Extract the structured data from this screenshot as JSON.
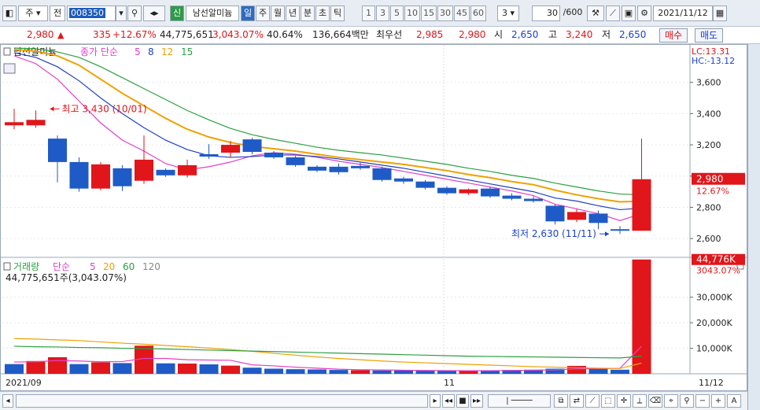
{
  "toolbar": {
    "market": "주",
    "type": "전",
    "code": "008350",
    "name_button": "신",
    "name": "남선알미늄",
    "periods": [
      "일",
      "주",
      "월",
      "년",
      "분",
      "초",
      "틱"
    ],
    "active_period": "일",
    "intervals": [
      "1",
      "3",
      "5",
      "10",
      "15",
      "30",
      "45",
      "60"
    ],
    "count": "3",
    "range": "30",
    "range_total": "/600",
    "date": "2021/11/12"
  },
  "quote": {
    "price": "2,980",
    "change": "335",
    "change_pct": "+12.67%",
    "volume": "44,775,651",
    "volume_ratio": "3,043.07%",
    "turnover": "40.64%",
    "amount": "136,664백만",
    "best_bid_label": "최우선",
    "best_bid": "2,985",
    "best_ask": "2,980",
    "open_label": "시",
    "open": "2,650",
    "high_label": "고",
    "high": "3,240",
    "low_label": "저",
    "low": "2,650",
    "buy_label": "매수",
    "sell_label": "매도"
  },
  "chart_data": [
    {
      "type": "candlestick",
      "legend": {
        "name": "남선알미늄",
        "series_label": "종가 단순",
        "ma_periods": [
          "5",
          "8",
          "12",
          "15"
        ]
      },
      "corner_labels": {
        "lc": "LC:13.31",
        "hc": "HC:-13.12"
      },
      "ylim": [
        2500,
        3820
      ],
      "yticks": [
        2600,
        2800,
        3000,
        3200,
        3400,
        3600
      ],
      "ytick_labels": [
        "2,600",
        "2,800",
        "3,000",
        "3,200",
        "3,400",
        "3,600"
      ],
      "current_price_label": "2,980",
      "current_change_label": "12.67%",
      "candles": [
        {
          "o": 3325,
          "h": 3430,
          "l": 3300,
          "c": 3345
        },
        {
          "o": 3325,
          "h": 3420,
          "l": 3310,
          "c": 3360
        },
        {
          "o": 3240,
          "h": 3260,
          "l": 2960,
          "c": 3090
        },
        {
          "o": 3090,
          "h": 3120,
          "l": 2900,
          "c": 2920
        },
        {
          "o": 2920,
          "h": 3090,
          "l": 2910,
          "c": 3075
        },
        {
          "o": 3050,
          "h": 3070,
          "l": 2905,
          "c": 2935
        },
        {
          "o": 2970,
          "h": 3260,
          "l": 2950,
          "c": 3105
        },
        {
          "o": 3040,
          "h": 3050,
          "l": 2995,
          "c": 3005
        },
        {
          "o": 3005,
          "h": 3105,
          "l": 2990,
          "c": 3070
        },
        {
          "o": 3140,
          "h": 3205,
          "l": 3110,
          "c": 3125
        },
        {
          "o": 3150,
          "h": 3225,
          "l": 3120,
          "c": 3200
        },
        {
          "o": 3235,
          "h": 3245,
          "l": 3140,
          "c": 3155
        },
        {
          "o": 3150,
          "h": 3160,
          "l": 3110,
          "c": 3120
        },
        {
          "o": 3120,
          "h": 3130,
          "l": 3060,
          "c": 3070
        },
        {
          "o": 3060,
          "h": 3070,
          "l": 3025,
          "c": 3035
        },
        {
          "o": 3060,
          "h": 3080,
          "l": 3010,
          "c": 3025
        },
        {
          "o": 3065,
          "h": 3085,
          "l": 3040,
          "c": 3050
        },
        {
          "o": 3050,
          "h": 3060,
          "l": 2965,
          "c": 2975
        },
        {
          "o": 2985,
          "h": 2995,
          "l": 2950,
          "c": 2965
        },
        {
          "o": 2965,
          "h": 2975,
          "l": 2915,
          "c": 2925
        },
        {
          "o": 2925,
          "h": 2935,
          "l": 2880,
          "c": 2890
        },
        {
          "o": 2890,
          "h": 2920,
          "l": 2880,
          "c": 2915
        },
        {
          "o": 2920,
          "h": 2930,
          "l": 2860,
          "c": 2870
        },
        {
          "o": 2875,
          "h": 2890,
          "l": 2845,
          "c": 2855
        },
        {
          "o": 2855,
          "h": 2870,
          "l": 2830,
          "c": 2840
        },
        {
          "o": 2810,
          "h": 2820,
          "l": 2690,
          "c": 2710
        },
        {
          "o": 2720,
          "h": 2790,
          "l": 2705,
          "c": 2770
        },
        {
          "o": 2760,
          "h": 2780,
          "l": 2660,
          "c": 2700
        },
        {
          "o": 2660,
          "h": 2680,
          "l": 2630,
          "c": 2650
        },
        {
          "o": 2650,
          "h": 3240,
          "l": 2650,
          "c": 2980
        }
      ],
      "ma": [
        {
          "period": "5",
          "color": "#e040c8",
          "values": [
            3770,
            3720,
            3620,
            3480,
            3340,
            3230,
            3160,
            3080,
            3040,
            3060,
            3090,
            3130,
            3150,
            3140,
            3120,
            3095,
            3075,
            3055,
            3030,
            3005,
            2980,
            2955,
            2930,
            2905,
            2875,
            2820,
            2790,
            2760,
            2715,
            2760
          ]
        },
        {
          "period": "8",
          "color": "#2040c0",
          "values": [
            3790,
            3760,
            3700,
            3610,
            3500,
            3400,
            3310,
            3230,
            3170,
            3130,
            3120,
            3125,
            3135,
            3135,
            3125,
            3110,
            3090,
            3070,
            3050,
            3025,
            3000,
            2975,
            2950,
            2925,
            2900,
            2860,
            2840,
            2810,
            2785,
            2795
          ]
        },
        {
          "period": "12",
          "color": "#f0a000",
          "values": [
            3810,
            3800,
            3770,
            3710,
            3620,
            3530,
            3450,
            3370,
            3300,
            3250,
            3215,
            3190,
            3175,
            3160,
            3140,
            3120,
            3105,
            3090,
            3075,
            3055,
            3035,
            3010,
            2990,
            2965,
            2945,
            2910,
            2880,
            2855,
            2835,
            2840
          ]
        },
        {
          "period": "15",
          "color": "#2aa040",
          "values": [
            3820,
            3815,
            3795,
            3760,
            3700,
            3630,
            3560,
            3490,
            3420,
            3360,
            3305,
            3265,
            3235,
            3210,
            3185,
            3165,
            3150,
            3135,
            3115,
            3095,
            3075,
            3050,
            3030,
            3005,
            2985,
            2955,
            2930,
            2905,
            2885,
            2880
          ]
        }
      ],
      "annotations": [
        {
          "text": "최고 3,430 (10/01)",
          "index": 1,
          "price": 3430,
          "side": "right",
          "color": "#e0161b"
        },
        {
          "text": "최저 2,630 (11/11)",
          "index": 28,
          "price": 2630,
          "side": "left",
          "color": "#1a3fd3"
        }
      ]
    },
    {
      "type": "bar",
      "legend": {
        "name": "거래량",
        "series_label": "단순",
        "ma_periods": [
          "5",
          "20",
          "60",
          "120"
        ],
        "summary": "44,775,651주(3,043.07%)"
      },
      "ylim": [
        0,
        45000000
      ],
      "yticks": [
        10000000,
        20000000,
        30000000
      ],
      "ytick_labels": [
        "10,000K",
        "20,000K",
        "30,000K"
      ],
      "current_label": "44,776K",
      "current_pct_label": "3043.07%",
      "values": [
        3800000,
        5000000,
        6500000,
        3800000,
        4500000,
        4200000,
        11000000,
        4100000,
        4000000,
        3700000,
        3200000,
        2400000,
        2000000,
        1800000,
        1700000,
        1500000,
        1400000,
        1300000,
        1300000,
        1200000,
        1100000,
        1200000,
        1400000,
        1500000,
        1600000,
        2000000,
        3100000,
        2000000,
        1600000,
        44775651
      ],
      "up": [
        false,
        true,
        true,
        false,
        true,
        false,
        true,
        false,
        true,
        false,
        true,
        false,
        false,
        false,
        false,
        false,
        true,
        false,
        false,
        false,
        false,
        true,
        false,
        false,
        false,
        false,
        true,
        false,
        false,
        true
      ],
      "ma": [
        {
          "period": "5",
          "color": "#e040c8",
          "values": [
            4600,
            4700,
            5200,
            5000,
            4700,
            4800,
            6000,
            6000,
            5500,
            5400,
            5300,
            3500,
            3100,
            2600,
            2200,
            1800,
            1600,
            1500,
            1400,
            1300,
            1250,
            1200,
            1220,
            1300,
            1400,
            1540,
            1920,
            2040,
            2140,
            10800
          ]
        },
        {
          "period": "20",
          "color": "#f0a000",
          "values": [
            13800,
            13600,
            13300,
            13000,
            12500,
            12000,
            11600,
            11100,
            10600,
            10100,
            9500,
            8800,
            8000,
            7300,
            6600,
            6000,
            5500,
            5000,
            4600,
            4300,
            4000,
            3700,
            3400,
            3100,
            2800,
            2600,
            2400,
            2200,
            2100,
            4200
          ]
        },
        {
          "period": "60",
          "color": "#2aa040",
          "values": [
            10800,
            10600,
            10500,
            10300,
            10200,
            10000,
            9900,
            9700,
            9500,
            9300,
            9100,
            8900,
            8700,
            8500,
            8300,
            8100,
            7900,
            7700,
            7500,
            7300,
            7100,
            6900,
            6800,
            6700,
            6600,
            6500,
            6400,
            6300,
            6200,
            6900
          ]
        }
      ]
    }
  ],
  "x_axis": {
    "left_label": "2021/09",
    "mid_label": "11",
    "right_label": "11/12"
  },
  "colors": {
    "up": "#e0161b",
    "down": "#1e5bc6",
    "accent": "#2d6cc0"
  }
}
